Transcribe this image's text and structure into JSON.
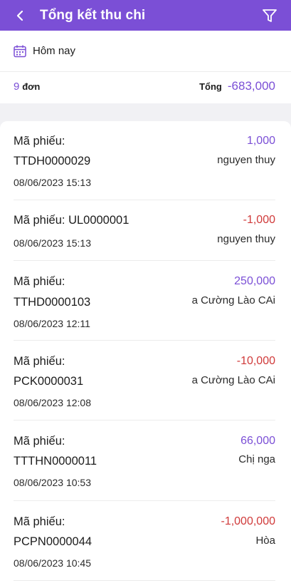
{
  "header": {
    "title": "Tổng kết thu chi"
  },
  "date_filter": {
    "label": "Hôm nay"
  },
  "summary": {
    "count": "9",
    "count_unit": "đơn",
    "total_label": "Tổng",
    "total_value": "-683,000"
  },
  "colors": {
    "accent": "#7b4fd6",
    "negative": "#d03a3a"
  },
  "receipts": [
    {
      "code_label": "Mã phiếu:",
      "code": "TTDH0000029",
      "datetime": "08/06/2023 15:13",
      "amount": "1,000",
      "customer": "nguyen thuy",
      "sign": "pos"
    },
    {
      "code_label": "Mã phiếu:",
      "code": "UL0000001",
      "datetime": "08/06/2023 15:13",
      "amount": "-1,000",
      "customer": "nguyen thuy",
      "sign": "neg"
    },
    {
      "code_label": "Mã phiếu:",
      "code": "TTHD0000103",
      "datetime": "08/06/2023 12:11",
      "amount": "250,000",
      "customer": "a Cường Lào CAi",
      "sign": "pos"
    },
    {
      "code_label": "Mã phiếu:",
      "code": "PCK0000031",
      "datetime": "08/06/2023 12:08",
      "amount": "-10,000",
      "customer": "a Cường Lào CAi",
      "sign": "neg"
    },
    {
      "code_label": "Mã phiếu:",
      "code": "TTTHN0000011",
      "datetime": "08/06/2023 10:53",
      "amount": "66,000",
      "customer": "Chị nga",
      "sign": "pos"
    },
    {
      "code_label": "Mã phiếu:",
      "code": "PCPN0000044",
      "datetime": "08/06/2023 10:45",
      "amount": "-1,000,000",
      "customer": "Hòa",
      "sign": "neg"
    }
  ]
}
